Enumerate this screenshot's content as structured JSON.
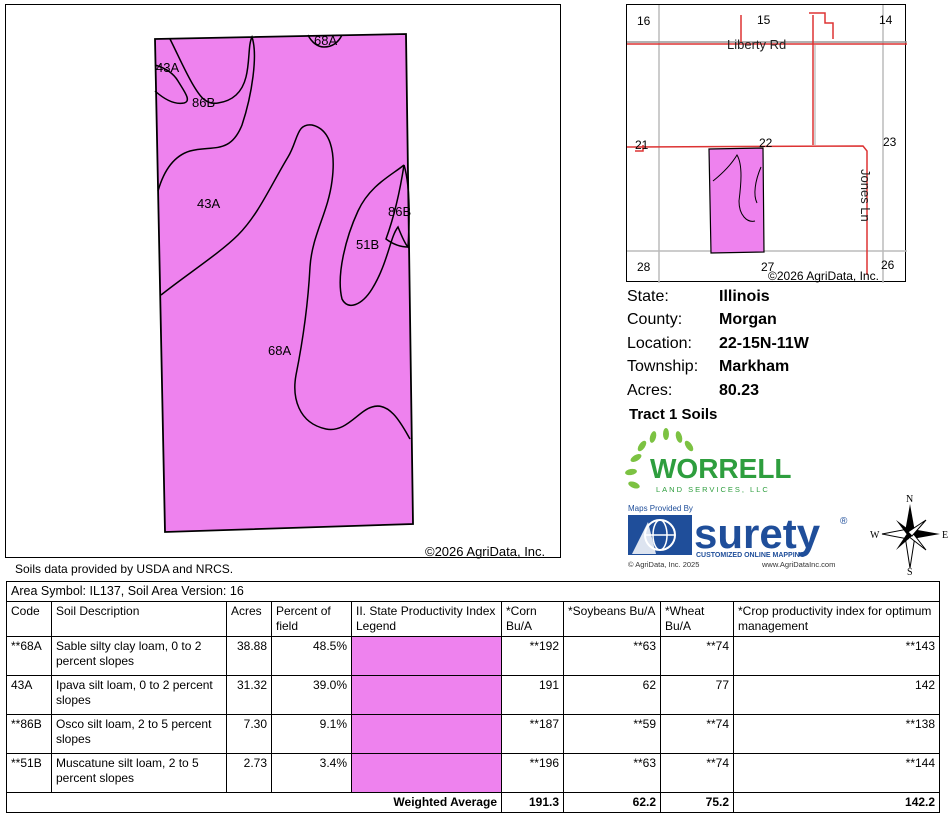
{
  "main_map": {
    "copyright": "©2026 AgriData, Inc.",
    "fill_color": "#ee82ee",
    "labels": {
      "68A_top": "68A",
      "43A_top": "43A",
      "86B_top": "86B",
      "43A_mid": "43A",
      "86B_right": "86B",
      "51B": "51B",
      "68A_mid": "68A"
    }
  },
  "source_note": "Soils data provided by USDA and NRCS.",
  "locator": {
    "sections": {
      "s16": "16",
      "s15": "15",
      "s14": "14",
      "s21": "21",
      "s22": "22",
      "s23": "23",
      "s28": "28",
      "s27": "27",
      "s26": "26"
    },
    "roads": {
      "liberty": "Liberty Rd",
      "jones": "Jones Ln"
    },
    "copyright": "©2026 AgriData, Inc."
  },
  "info": {
    "state_label": "State:",
    "state": "Illinois",
    "county_label": "County:",
    "county": "Morgan",
    "location_label": "Location:",
    "location": "22-15N-11W",
    "township_label": "Township:",
    "township": "Markham",
    "acres_label": "Acres:",
    "acres": "80.23"
  },
  "tract_title": "Tract 1 Soils",
  "worrell": {
    "name": "WORRELL",
    "sub": "LAND SERVICES, LLC",
    "color": "#2e9e3e"
  },
  "surety": {
    "provided_by": "Maps Provided By",
    "name": "surety",
    "reg": "®",
    "tagline": "CUSTOMIZED ONLINE MAPPING",
    "copyright": "© AgriData, Inc. 2025",
    "url": "www.AgriDataInc.com",
    "color": "#1f4e9a"
  },
  "compass": {
    "n": "N",
    "s": "S",
    "e": "E",
    "w": "W"
  },
  "table": {
    "area_symbol": "Area Symbol: IL137, Soil Area Version: 16",
    "headers": {
      "code": "Code",
      "desc": "Soil Description",
      "acres": "Acres",
      "pct": "Percent of field",
      "legend": "II. State Productivity Index Legend",
      "corn": "*Corn Bu/A",
      "soy": "*Soybeans Bu/A",
      "wheat": "*Wheat Bu/A",
      "cpi": "*Crop productivity index for optimum management"
    },
    "rows": [
      {
        "code": "**68A",
        "desc": "Sable silty clay loam, 0 to 2 percent slopes",
        "acres": "38.88",
        "pct": "48.5%",
        "corn": "**192",
        "soy": "**63",
        "wheat": "**74",
        "cpi": "**143"
      },
      {
        "code": "43A",
        "desc": "Ipava silt loam, 0 to 2 percent slopes",
        "acres": "31.32",
        "pct": "39.0%",
        "corn": "191",
        "soy": "62",
        "wheat": "77",
        "cpi": "142"
      },
      {
        "code": "**86B",
        "desc": "Osco silt loam, 2 to 5 percent slopes",
        "acres": "7.30",
        "pct": "9.1%",
        "corn": "**187",
        "soy": "**59",
        "wheat": "**74",
        "cpi": "**138"
      },
      {
        "code": "**51B",
        "desc": "Muscatune silt loam, 2 to 5 percent slopes",
        "acres": "2.73",
        "pct": "3.4%",
        "corn": "**196",
        "soy": "**63",
        "wheat": "**74",
        "cpi": "**144"
      }
    ],
    "weighted": {
      "label": "Weighted Average",
      "corn": "191.3",
      "soy": "62.2",
      "wheat": "75.2",
      "cpi": "142.2"
    }
  }
}
